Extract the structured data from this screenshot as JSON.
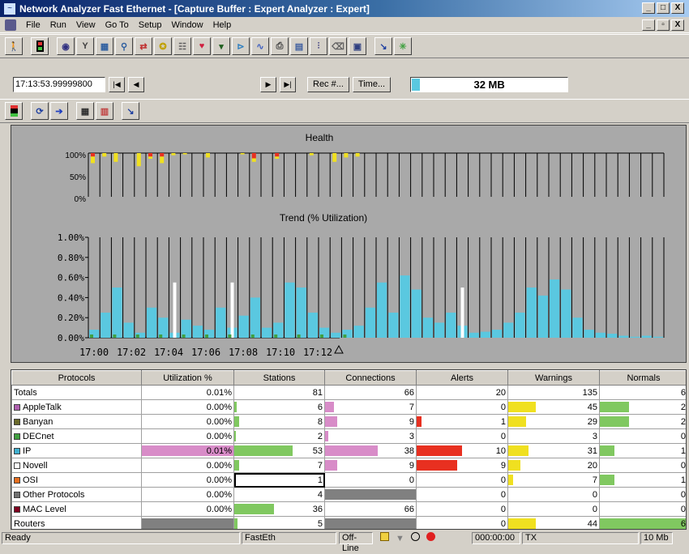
{
  "window": {
    "title": "Network Analyzer Fast Ethernet - [Capture Buffer : Expert Analyzer : Expert]",
    "min": "_",
    "max": "□",
    "close": "X",
    "mdi_min": "_",
    "mdi_restore": "▫",
    "mdi_close": "X"
  },
  "menu": [
    "File",
    "Run",
    "View",
    "Go To",
    "Setup",
    "Window",
    "Help"
  ],
  "toolbar_icons": [
    "walk-icon",
    "stop-icon",
    "capture-icon",
    "filter-icon",
    "network-icon",
    "station-icon",
    "pair-icon",
    "expert-icon",
    "grid-icon",
    "heart-icon",
    "dropdown-filter-icon",
    "protocol-icon",
    "graph-icon",
    "print-icon",
    "table-icon",
    "decode-icon",
    "trash-icon",
    "matrix-icon",
    "pointer-icon",
    "sparkle-icon"
  ],
  "nav": {
    "time": "17:13:53.99999800",
    "rec_label": "Rec #...",
    "time_label": "Time...",
    "buffer": "32 MB",
    "buffer_fill": 0.05
  },
  "toolbar3_icons": [
    "stop-icon",
    "refresh-icon",
    "arrow-right-icon",
    "grid-view-icon",
    "chart-view-icon",
    "pointer-icon"
  ],
  "colors": {
    "red": "#e83020",
    "yellow": "#f0e020",
    "cyan": "#5ac8e0",
    "pink": "#d88cc8",
    "green": "#80c860",
    "gray": "#808080",
    "white": "#ffffff"
  },
  "chart_data": [
    {
      "type": "bar",
      "title": "Health",
      "ylabel": "",
      "yticks": [
        "100%",
        "50%",
        "0%"
      ],
      "ylim": [
        0,
        100
      ],
      "note": "red/yellow bars hanging from 100% indicate alerts and warnings per interval",
      "series": [
        {
          "color": "red",
          "values": [
            8,
            0,
            0,
            0,
            0,
            8,
            8,
            0,
            0,
            0,
            0,
            0,
            0,
            0,
            12,
            0,
            8,
            0,
            0,
            0,
            0,
            0,
            0,
            0,
            0,
            0,
            0,
            0,
            0,
            0,
            0,
            0,
            0,
            0,
            0,
            0,
            0,
            0,
            0,
            0,
            0,
            0,
            0,
            0,
            0,
            0,
            0,
            0,
            0,
            0
          ]
        },
        {
          "color": "yellow",
          "values": [
            15,
            8,
            20,
            0,
            30,
            5,
            15,
            5,
            3,
            0,
            10,
            0,
            0,
            3,
            8,
            0,
            5,
            0,
            0,
            5,
            0,
            20,
            10,
            8,
            0,
            0,
            0,
            0,
            0,
            0,
            0,
            0,
            0,
            0,
            0,
            0,
            0,
            0,
            0,
            0,
            0,
            0,
            0,
            0,
            0,
            0,
            0,
            0,
            0,
            0
          ]
        }
      ]
    },
    {
      "type": "bar",
      "title": "Trend (% Utilization)",
      "yticks": [
        "1.00%",
        "0.80%",
        "0.60%",
        "0.40%",
        "0.20%",
        "0.00%"
      ],
      "xticks": [
        "17:00",
        "17:02",
        "17:04",
        "17:06",
        "17:08",
        "17:10",
        "17:12"
      ],
      "ylim": [
        0,
        1.0
      ],
      "series": [
        {
          "name": "IP",
          "color": "cyan",
          "values": [
            0.08,
            0.25,
            0.5,
            0.15,
            0.05,
            0.3,
            0.2,
            0.05,
            0.18,
            0.12,
            0.08,
            0.3,
            0.1,
            0.22,
            0.4,
            0.1,
            0.15,
            0.55,
            0.5,
            0.25,
            0.1,
            0.05,
            0.08,
            0.12,
            0.3,
            0.55,
            0.25,
            0.62,
            0.48,
            0.2,
            0.15,
            0.25,
            0.12,
            0.05,
            0.06,
            0.08,
            0.15,
            0.25,
            0.5,
            0.42,
            0.58,
            0.48,
            0.2,
            0.08,
            0.05,
            0.04,
            0.02,
            0.01,
            0.02,
            0.01
          ]
        },
        {
          "name": "Novell",
          "color": "white",
          "values": [
            0,
            0,
            0,
            0,
            0,
            0,
            0,
            0.55,
            0,
            0,
            0,
            0,
            0.55,
            0,
            0,
            0,
            0,
            0,
            0,
            0,
            0,
            0,
            0,
            0,
            0,
            0,
            0,
            0,
            0,
            0,
            0,
            0,
            0.5,
            0,
            0,
            0,
            0,
            0,
            0,
            0,
            0,
            0,
            0,
            0,
            0,
            0,
            0,
            0,
            0,
            0
          ]
        }
      ]
    }
  ],
  "table": {
    "headers": [
      "Protocols",
      "Utilization %",
      "Stations",
      "Connections",
      "Alerts",
      "Warnings",
      "Normals"
    ],
    "rows": [
      {
        "name": "Totals",
        "swatch": "",
        "util": "0.01%",
        "stations": "81",
        "connections": "66",
        "alerts": "20",
        "warnings": "135",
        "normals": "6",
        "bars": {}
      },
      {
        "name": "AppleTalk",
        "swatch": "#b060b0",
        "util": "0.00%",
        "stations": "6",
        "connections": "7",
        "alerts": "0",
        "warnings": "45",
        "normals": "2",
        "bars": {
          "stations": [
            0.03,
            "green"
          ],
          "connections": [
            0.1,
            "pink"
          ],
          "warnings": [
            0.3,
            "yellow"
          ],
          "normals": [
            0.33,
            "green"
          ]
        }
      },
      {
        "name": "Banyan",
        "swatch": "#6a6a2a",
        "util": "0.00%",
        "stations": "8",
        "connections": "9",
        "alerts": "1",
        "warnings": "29",
        "normals": "2",
        "bars": {
          "stations": [
            0.05,
            "green"
          ],
          "connections": [
            0.13,
            "pink"
          ],
          "alerts": [
            0.05,
            "red"
          ],
          "warnings": [
            0.2,
            "yellow"
          ],
          "normals": [
            0.33,
            "green"
          ]
        }
      },
      {
        "name": "DECnet",
        "swatch": "#40a040",
        "util": "0.00%",
        "stations": "2",
        "connections": "3",
        "alerts": "0",
        "warnings": "3",
        "normals": "0",
        "bars": {
          "stations": [
            0.02,
            "green"
          ],
          "connections": [
            0.04,
            "pink"
          ]
        }
      },
      {
        "name": "IP",
        "swatch": "#40b0d0",
        "util": "0.01%",
        "stations": "53",
        "connections": "38",
        "alerts": "10",
        "warnings": "31",
        "normals": "1",
        "bars": {
          "util": [
            1.0,
            "pink"
          ],
          "stations": [
            0.65,
            "green"
          ],
          "connections": [
            0.58,
            "pink"
          ],
          "alerts": [
            0.5,
            "red"
          ],
          "warnings": [
            0.22,
            "yellow"
          ],
          "normals": [
            0.17,
            "green"
          ]
        }
      },
      {
        "name": "Novell",
        "swatch": "#ffffff",
        "util": "0.00%",
        "stations": "7",
        "connections": "9",
        "alerts": "9",
        "warnings": "20",
        "normals": "0",
        "bars": {
          "stations": [
            0.05,
            "green"
          ],
          "connections": [
            0.13,
            "pink"
          ],
          "alerts": [
            0.45,
            "red"
          ],
          "warnings": [
            0.13,
            "yellow"
          ]
        }
      },
      {
        "name": "OSI",
        "swatch": "#e87020",
        "util": "0.00%",
        "stations": "1",
        "connections": "0",
        "alerts": "0",
        "warnings": "7",
        "normals": "1",
        "bars": {
          "warnings": [
            0.05,
            "yellow"
          ],
          "normals": [
            0.17,
            "green"
          ]
        }
      },
      {
        "name": "Other Protocols",
        "swatch": "#707070",
        "util": "0.00%",
        "stations": "4",
        "connections": "",
        "alerts": "0",
        "warnings": "0",
        "normals": "0",
        "bars": {
          "connections": [
            1.0,
            "gray"
          ]
        }
      },
      {
        "name": "MAC Level",
        "swatch": "#800020",
        "util": "0.00%",
        "stations": "36",
        "connections": "66",
        "alerts": "0",
        "warnings": "0",
        "normals": "0",
        "bars": {
          "stations": [
            0.44,
            "green"
          ]
        }
      },
      {
        "name": "Routers",
        "swatch": "",
        "util": "",
        "stations": "5",
        "connections": "",
        "alerts": "0",
        "warnings": "44",
        "normals": "6",
        "bars": {
          "util": [
            1.0,
            "gray"
          ],
          "stations": [
            0.04,
            "green"
          ],
          "connections": [
            1.0,
            "gray"
          ],
          "warnings": [
            0.3,
            "yellow"
          ],
          "normals": [
            1.0,
            "green"
          ]
        }
      }
    ]
  },
  "status": {
    "ready": "Ready",
    "adapter": "FastEth",
    "mode": "Off-Line",
    "elapsed": "000:00:00",
    "dir": "TX",
    "speed": "10 Mb"
  }
}
